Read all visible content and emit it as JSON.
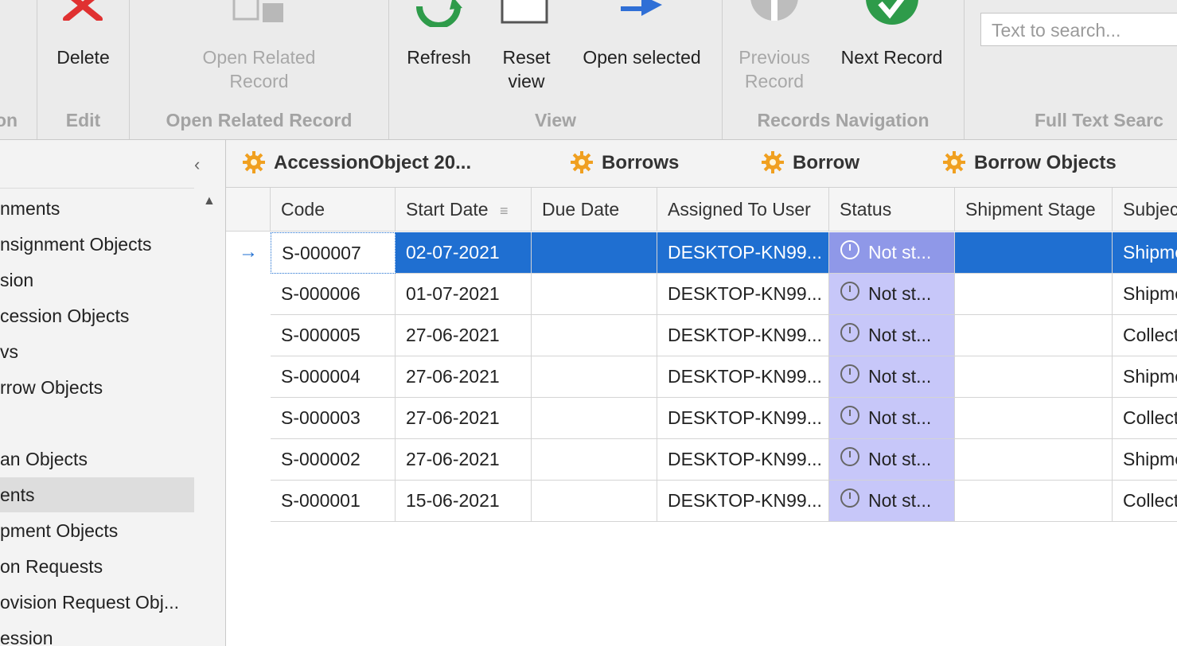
{
  "ribbon": {
    "buttons": {
      "delete": "Delete",
      "open_related_line1": "Open Related",
      "open_related_line2": "Record",
      "refresh": "Refresh",
      "reset_line1": "Reset",
      "reset_line2": "view",
      "open_selected": "Open selected",
      "prev_line1": "Previous",
      "prev_line2": "Record",
      "next": "Next Record"
    },
    "groups": {
      "first": "on",
      "edit": "Edit",
      "open_related": "Open Related Record",
      "view": "View",
      "records_navigation": "Records Navigation",
      "full_text_search": "Full Text Searc"
    },
    "search_placeholder": "Text to search..."
  },
  "nav": {
    "items": [
      {
        "label": "nments",
        "selected": false
      },
      {
        "label": "nsignment Objects",
        "selected": false
      },
      {
        "label": "sion",
        "selected": false
      },
      {
        "label": "cession Objects",
        "selected": false
      },
      {
        "label": "vs",
        "selected": false
      },
      {
        "label": "rrow Objects",
        "selected": false
      },
      {
        "label": "",
        "selected": false
      },
      {
        "label": "an Objects",
        "selected": false
      },
      {
        "label": "ents",
        "selected": true
      },
      {
        "label": "pment Objects",
        "selected": false
      },
      {
        "label": "on Requests",
        "selected": false
      },
      {
        "label": "ovision Request Obj...",
        "selected": false
      },
      {
        "label": "ession",
        "selected": false
      }
    ]
  },
  "tabs": [
    {
      "label": "AccessionObject 20..."
    },
    {
      "label": "Borrows"
    },
    {
      "label": "Borrow"
    },
    {
      "label": "Borrow Objects"
    }
  ],
  "grid": {
    "columns": {
      "code": "Code",
      "start": "Start Date",
      "due": "Due Date",
      "assigned": "Assigned To User",
      "status": "Status",
      "stage": "Shipment Stage",
      "subject": "Subjec"
    },
    "rows": [
      {
        "code": "S-000007",
        "start": "02-07-2021",
        "due": "",
        "assigned": "DESKTOP-KN99...",
        "status": "Not st...",
        "stage": "",
        "subject": "Shipme"
      },
      {
        "code": "S-000006",
        "start": "01-07-2021",
        "due": "",
        "assigned": "DESKTOP-KN99...",
        "status": "Not st...",
        "stage": "",
        "subject": "Shipme"
      },
      {
        "code": "S-000005",
        "start": "27-06-2021",
        "due": "",
        "assigned": "DESKTOP-KN99...",
        "status": "Not st...",
        "stage": "",
        "subject": "Collect"
      },
      {
        "code": "S-000004",
        "start": "27-06-2021",
        "due": "",
        "assigned": "DESKTOP-KN99...",
        "status": "Not st...",
        "stage": "",
        "subject": "Shipme"
      },
      {
        "code": "S-000003",
        "start": "27-06-2021",
        "due": "",
        "assigned": "DESKTOP-KN99...",
        "status": "Not st...",
        "stage": "",
        "subject": "Collect"
      },
      {
        "code": "S-000002",
        "start": "27-06-2021",
        "due": "",
        "assigned": "DESKTOP-KN99...",
        "status": "Not st...",
        "stage": "",
        "subject": "Shipme"
      },
      {
        "code": "S-000001",
        "start": "15-06-2021",
        "due": "",
        "assigned": "DESKTOP-KN99...",
        "status": "Not st...",
        "stage": "",
        "subject": "Collect"
      }
    ]
  },
  "colors": {
    "selection": "#1f6fd1",
    "status_bg": "#c7c7f9",
    "delete_icon": "#e03131",
    "refresh_icon": "#2e9b4a",
    "open_selected_icon": "#2f6fd6",
    "next_icon": "#2e9b4a",
    "tab_icon": "#f0a020"
  },
  "icons": {
    "delete": "delete-x-icon",
    "open_related": "open-related-icon",
    "refresh": "refresh-icon",
    "reset": "reset-view-icon",
    "open_selected": "open-selected-arrow-icon",
    "previous": "previous-record-icon",
    "next": "next-record-icon",
    "tab": "gear-icon",
    "status": "clock-icon"
  }
}
